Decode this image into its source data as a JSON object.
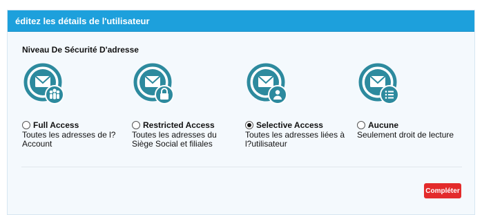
{
  "dialog": {
    "title": "éditez les détails de l'utilisateur",
    "section_title": "Niveau De Sécurité D'adresse"
  },
  "options": [
    {
      "label": "Full Access",
      "description": "Toutes les adresses de l? Account",
      "checked": false,
      "icon": "envelope-users-icon"
    },
    {
      "label": "Restricted Access",
      "description": "Toutes les adresses du Siège Social et filiales",
      "checked": false,
      "icon": "envelope-lock-icon"
    },
    {
      "label": "Selective Access",
      "description": "Toutes les adresses liées à l?utilisateur",
      "checked": true,
      "icon": "envelope-user-icon"
    },
    {
      "label": "Aucune",
      "description": "Seulement droit de lecture",
      "checked": false,
      "icon": "envelope-list-icon"
    }
  ],
  "actions": {
    "complete_label": "Compléter"
  },
  "colors": {
    "header": "#1da0dc",
    "icon_teal": "#2d8a9e",
    "button_red": "#e32b2b"
  }
}
